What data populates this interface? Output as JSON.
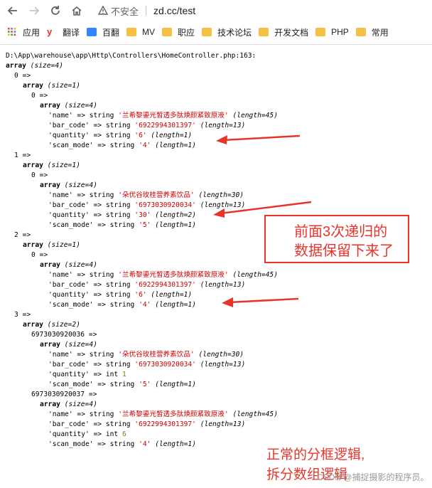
{
  "browser": {
    "security_label": "不安全",
    "url": "zd.cc/test",
    "bookmarks": [
      {
        "label": "应用",
        "icon": "apps-grid-icon"
      },
      {
        "label": "翻译",
        "icon": "youdao-icon"
      },
      {
        "label": "百翻",
        "icon": "baidu-translate-icon"
      },
      {
        "label": "MV",
        "icon": "folder-icon"
      },
      {
        "label": "职应",
        "icon": "folder-icon"
      },
      {
        "label": "技术论坛",
        "icon": "folder-icon"
      },
      {
        "label": "开发文档",
        "icon": "folder-icon"
      },
      {
        "label": "PHP",
        "icon": "folder-icon"
      },
      {
        "label": "常用",
        "icon": "folder-icon"
      }
    ]
  },
  "dump": {
    "path": "D:\\App\\warehouse\\app\\Http\\Controllers\\HomeController.php:163:",
    "lines": [
      {
        "indent": 0,
        "parts": [
          {
            "t": "array",
            "c": "kw"
          },
          {
            "t": " "
          },
          {
            "t": "(size=4)",
            "c": "it"
          }
        ]
      },
      {
        "indent": 2,
        "parts": [
          {
            "t": "0 =>"
          }
        ]
      },
      {
        "indent": 4,
        "parts": [
          {
            "t": "array",
            "c": "kw"
          },
          {
            "t": " "
          },
          {
            "t": "(size=1)",
            "c": "it"
          }
        ]
      },
      {
        "indent": 6,
        "parts": [
          {
            "t": "0 =>"
          }
        ]
      },
      {
        "indent": 8,
        "parts": [
          {
            "t": "array",
            "c": "kw"
          },
          {
            "t": " "
          },
          {
            "t": "(size=4)",
            "c": "it"
          }
        ]
      },
      {
        "indent": 10,
        "parts": [
          {
            "t": "'name' => string "
          },
          {
            "t": "'兰希黎鎏光皙透多肽焕颜紧致原液'",
            "c": "str"
          },
          {
            "t": " "
          },
          {
            "t": "(length=45)",
            "c": "it"
          }
        ]
      },
      {
        "indent": 10,
        "parts": [
          {
            "t": "'bar_code' => string "
          },
          {
            "t": "'6922994301397'",
            "c": "str"
          },
          {
            "t": " "
          },
          {
            "t": "(length=13)",
            "c": "it"
          }
        ]
      },
      {
        "indent": 10,
        "parts": [
          {
            "t": "'quantity' => string "
          },
          {
            "t": "'6'",
            "c": "str"
          },
          {
            "t": " "
          },
          {
            "t": "(length=1)",
            "c": "it"
          }
        ]
      },
      {
        "indent": 10,
        "parts": [
          {
            "t": "'scan_mode' => string "
          },
          {
            "t": "'4'",
            "c": "str"
          },
          {
            "t": " "
          },
          {
            "t": "(length=1)",
            "c": "it"
          }
        ]
      },
      {
        "indent": 2,
        "parts": [
          {
            "t": "1 =>"
          }
        ]
      },
      {
        "indent": 4,
        "parts": [
          {
            "t": "array",
            "c": "kw"
          },
          {
            "t": " "
          },
          {
            "t": "(size=1)",
            "c": "it"
          }
        ]
      },
      {
        "indent": 6,
        "parts": [
          {
            "t": "0 =>"
          }
        ]
      },
      {
        "indent": 8,
        "parts": [
          {
            "t": "array",
            "c": "kw"
          },
          {
            "t": " "
          },
          {
            "t": "(size=4)",
            "c": "it"
          }
        ]
      },
      {
        "indent": 10,
        "parts": [
          {
            "t": "'name' => string "
          },
          {
            "t": "'朵优谷玫桂营养素饮品'",
            "c": "str"
          },
          {
            "t": " "
          },
          {
            "t": "(length=30)",
            "c": "it"
          }
        ]
      },
      {
        "indent": 10,
        "parts": [
          {
            "t": "'bar_code' => string "
          },
          {
            "t": "'6973030920034'",
            "c": "str"
          },
          {
            "t": " "
          },
          {
            "t": "(length=13)",
            "c": "it"
          }
        ]
      },
      {
        "indent": 10,
        "parts": [
          {
            "t": "'quantity' => string "
          },
          {
            "t": "'30'",
            "c": "str"
          },
          {
            "t": " "
          },
          {
            "t": "(length=2)",
            "c": "it"
          }
        ]
      },
      {
        "indent": 10,
        "parts": [
          {
            "t": "'scan_mode' => string "
          },
          {
            "t": "'5'",
            "c": "str"
          },
          {
            "t": " "
          },
          {
            "t": "(length=1)",
            "c": "it"
          }
        ]
      },
      {
        "indent": 2,
        "parts": [
          {
            "t": "2 =>"
          }
        ]
      },
      {
        "indent": 4,
        "parts": [
          {
            "t": "array",
            "c": "kw"
          },
          {
            "t": " "
          },
          {
            "t": "(size=1)",
            "c": "it"
          }
        ]
      },
      {
        "indent": 6,
        "parts": [
          {
            "t": "0 =>"
          }
        ]
      },
      {
        "indent": 8,
        "parts": [
          {
            "t": "array",
            "c": "kw"
          },
          {
            "t": " "
          },
          {
            "t": "(size=4)",
            "c": "it"
          }
        ]
      },
      {
        "indent": 10,
        "parts": [
          {
            "t": "'name' => string "
          },
          {
            "t": "'兰希黎鎏光皙透多肽焕颜紧致原液'",
            "c": "str"
          },
          {
            "t": " "
          },
          {
            "t": "(length=45)",
            "c": "it"
          }
        ]
      },
      {
        "indent": 10,
        "parts": [
          {
            "t": "'bar_code' => string "
          },
          {
            "t": "'6922994301397'",
            "c": "str"
          },
          {
            "t": " "
          },
          {
            "t": "(length=13)",
            "c": "it"
          }
        ]
      },
      {
        "indent": 10,
        "parts": [
          {
            "t": "'quantity' => string "
          },
          {
            "t": "'6'",
            "c": "str"
          },
          {
            "t": " "
          },
          {
            "t": "(length=1)",
            "c": "it"
          }
        ]
      },
      {
        "indent": 10,
        "parts": [
          {
            "t": "'scan_mode' => string "
          },
          {
            "t": "'4'",
            "c": "str"
          },
          {
            "t": " "
          },
          {
            "t": "(length=1)",
            "c": "it"
          }
        ]
      },
      {
        "indent": 2,
        "parts": [
          {
            "t": "3 =>"
          }
        ]
      },
      {
        "indent": 4,
        "parts": [
          {
            "t": "array",
            "c": "kw"
          },
          {
            "t": " "
          },
          {
            "t": "(size=2)",
            "c": "it"
          }
        ]
      },
      {
        "indent": 6,
        "parts": [
          {
            "t": "6973030920036 =>"
          }
        ]
      },
      {
        "indent": 8,
        "parts": [
          {
            "t": "array",
            "c": "kw"
          },
          {
            "t": " "
          },
          {
            "t": "(size=4)",
            "c": "it"
          }
        ]
      },
      {
        "indent": 10,
        "parts": [
          {
            "t": "'name' => string "
          },
          {
            "t": "'朵优谷玫桂营养素饮品'",
            "c": "str"
          },
          {
            "t": " "
          },
          {
            "t": "(length=30)",
            "c": "it"
          }
        ]
      },
      {
        "indent": 10,
        "parts": [
          {
            "t": "'bar_code' => string "
          },
          {
            "t": "'6973030920034'",
            "c": "str"
          },
          {
            "t": " "
          },
          {
            "t": "(length=13)",
            "c": "it"
          }
        ]
      },
      {
        "indent": 10,
        "parts": [
          {
            "t": "'quantity' => int "
          },
          {
            "t": "1",
            "c": "num"
          }
        ]
      },
      {
        "indent": 10,
        "parts": [
          {
            "t": "'scan_mode' => string "
          },
          {
            "t": "'5'",
            "c": "str"
          },
          {
            "t": " "
          },
          {
            "t": "(length=1)",
            "c": "it"
          }
        ]
      },
      {
        "indent": 6,
        "parts": [
          {
            "t": "6973030920037 =>"
          }
        ]
      },
      {
        "indent": 8,
        "parts": [
          {
            "t": "array",
            "c": "kw"
          },
          {
            "t": " "
          },
          {
            "t": "(size=4)",
            "c": "it"
          }
        ]
      },
      {
        "indent": 10,
        "parts": [
          {
            "t": "'name' => string "
          },
          {
            "t": "'兰希黎鎏光皙透多肽焕颜紧致原液'",
            "c": "str"
          },
          {
            "t": " "
          },
          {
            "t": "(length=45)",
            "c": "it"
          }
        ]
      },
      {
        "indent": 10,
        "parts": [
          {
            "t": "'bar_code' => string "
          },
          {
            "t": "'6922994301397'",
            "c": "str"
          },
          {
            "t": " "
          },
          {
            "t": "(length=13)",
            "c": "it"
          }
        ]
      },
      {
        "indent": 10,
        "parts": [
          {
            "t": "'quantity' => int "
          },
          {
            "t": "6",
            "c": "num"
          }
        ]
      },
      {
        "indent": 10,
        "parts": [
          {
            "t": "'scan_mode' => string "
          },
          {
            "t": "'4'",
            "c": "str"
          },
          {
            "t": " "
          },
          {
            "t": "(length=1)",
            "c": "it"
          }
        ]
      }
    ]
  },
  "annotations": {
    "recursion_note_line1": "前面3次递归的",
    "recursion_note_line2": "数据保留下来了",
    "correct_note_line1": "正常的分框逻辑,",
    "correct_note_line2": "拆分数组逻辑",
    "accent_color": "#e8342b"
  },
  "watermark": "CSDN @捕捉摄影的程序员。"
}
